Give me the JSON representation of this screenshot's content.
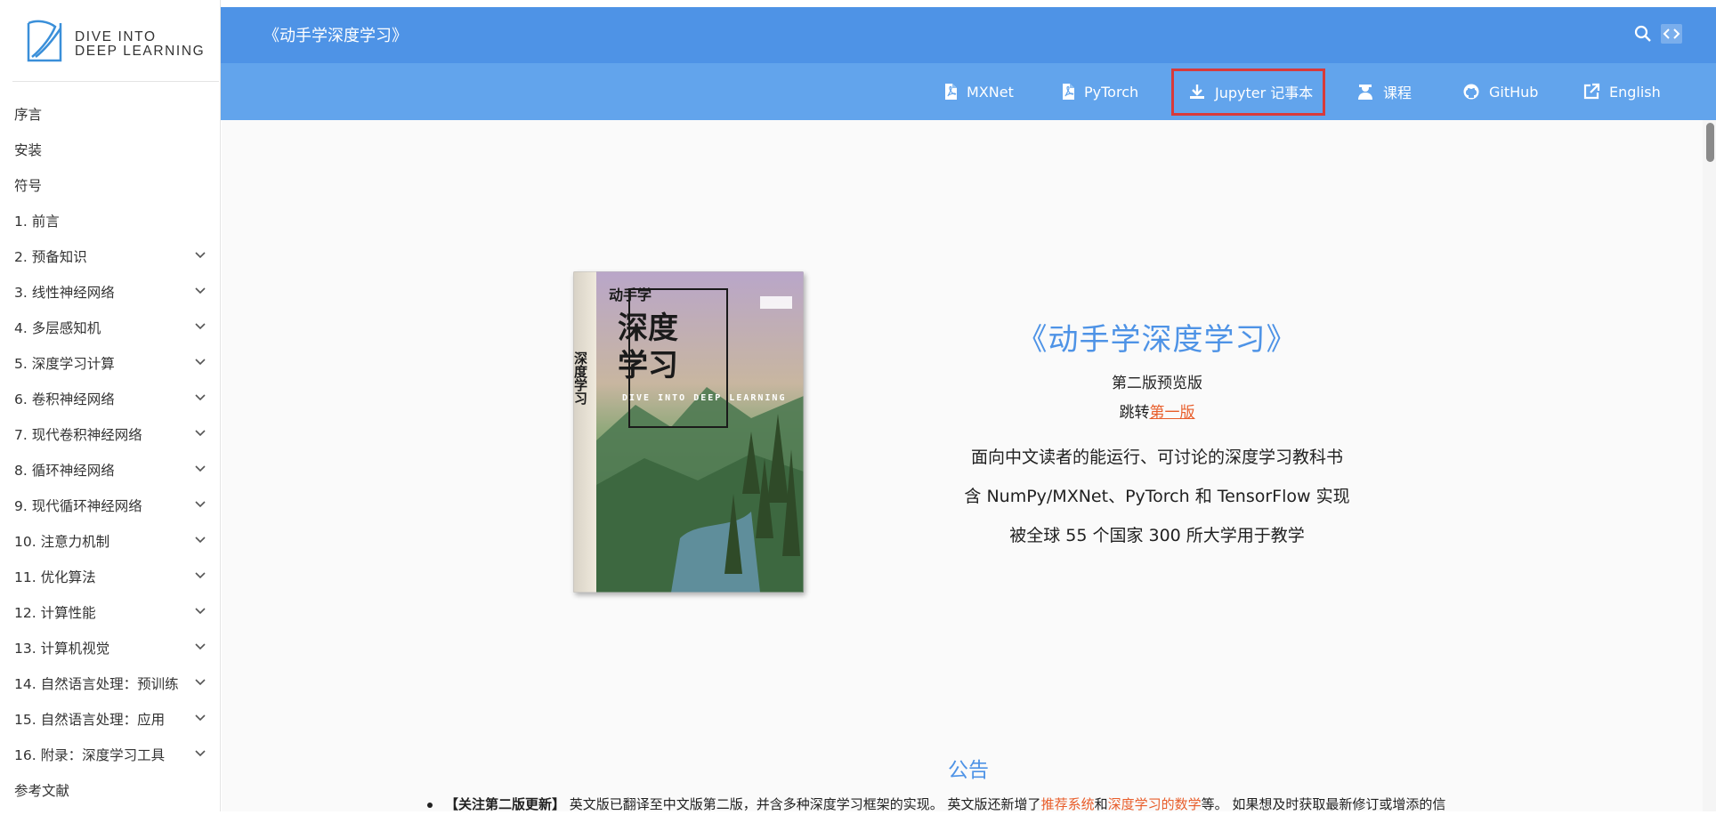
{
  "logo": {
    "line1": "DIVE INTO",
    "line2": "DEEP LEARNING"
  },
  "sidebar": {
    "items": [
      {
        "label": "序言",
        "expandable": false
      },
      {
        "label": "安装",
        "expandable": false
      },
      {
        "label": "符号",
        "expandable": false
      },
      {
        "label": "1. 前言",
        "expandable": false
      },
      {
        "label": "2. 预备知识",
        "expandable": true
      },
      {
        "label": "3. 线性神经网络",
        "expandable": true
      },
      {
        "label": "4. 多层感知机",
        "expandable": true
      },
      {
        "label": "5. 深度学习计算",
        "expandable": true
      },
      {
        "label": "6. 卷积神经网络",
        "expandable": true
      },
      {
        "label": "7. 现代卷积神经网络",
        "expandable": true
      },
      {
        "label": "8. 循环神经网络",
        "expandable": true
      },
      {
        "label": "9. 现代循环神经网络",
        "expandable": true
      },
      {
        "label": "10. 注意力机制",
        "expandable": true
      },
      {
        "label": "11. 优化算法",
        "expandable": true
      },
      {
        "label": "12. 计算性能",
        "expandable": true
      },
      {
        "label": "13. 计算机视觉",
        "expandable": true
      },
      {
        "label": "14. 自然语言处理：预训练",
        "expandable": true
      },
      {
        "label": "15. 自然语言处理：应用",
        "expandable": true
      },
      {
        "label": "16. 附录：深度学习工具",
        "expandable": true
      },
      {
        "label": "参考文献",
        "expandable": false
      }
    ]
  },
  "header": {
    "title": "《动手学深度学习》",
    "nav": [
      {
        "label": "MXNet",
        "icon": "pdf-icon"
      },
      {
        "label": "PyTorch",
        "icon": "pdf-icon"
      },
      {
        "label": "Jupyter 记事本",
        "icon": "download-icon"
      },
      {
        "label": "课程",
        "icon": "teacher-icon"
      },
      {
        "label": "GitHub",
        "icon": "github-icon"
      },
      {
        "label": "English",
        "icon": "external-link-icon"
      }
    ]
  },
  "cover": {
    "brand": "动手学",
    "title_line1": "深度",
    "title_line2": "学习",
    "spine": "深度学习",
    "english": "DIVE INTO DEEP LEARNING"
  },
  "hero": {
    "title": "《动手学深度学习》",
    "edition": "第二版预览版",
    "jump_prefix": "跳转",
    "jump_link": "第一版",
    "line1": "面向中文读者的能运行、可讨论的深度学习教科书",
    "line2": "含 NumPy/MXNet、PyTorch 和 TensorFlow 实现",
    "line3": "被全球 55 个国家 300 所大学用于教学"
  },
  "notice": {
    "title": "公告",
    "bold": "【关注第二版更新】",
    "text1": " 英文版已翻译至中文版第二版，并含多种深度学习框架的实现。 英文版还新增了",
    "link1": "推荐系统",
    "text2": "和",
    "link2": "深度学习的数学",
    "text3": "等。 如果想及时获取最新修订或增添的信"
  },
  "colors": {
    "header_top": "#4e93e6",
    "header_nav": "#62a4ec",
    "link": "#e85d2a",
    "highlight_box": "#d83a3a"
  }
}
